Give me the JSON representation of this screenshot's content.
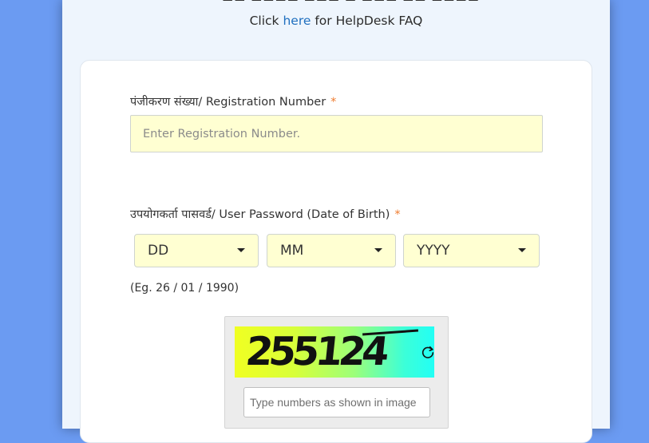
{
  "header": {
    "help_prefix": "Click ",
    "help_link": "here",
    "help_suffix": " for HelpDesk FAQ"
  },
  "form": {
    "registration": {
      "label": "पंजीकरण संख्या/ Registration Number",
      "required_mark": "*",
      "placeholder": "Enter Registration Number."
    },
    "password": {
      "label": "उपयोगकर्ता पासवर्ड/ User Password (Date of Birth)",
      "required_mark": "*",
      "day_selected": "DD",
      "month_selected": "MM",
      "year_selected": "YYYY",
      "example": "(Eg. 26 / 01 / 1990)"
    },
    "captcha": {
      "code": "255124",
      "refresh_icon": "refresh-icon",
      "placeholder": "Type numbers as shown in image"
    }
  },
  "colors": {
    "background": "#6b9bf2",
    "panel": "#eef5fd",
    "input_fill": "#ffffd2",
    "link": "#1f6fbf",
    "required": "#ef7b2e"
  }
}
